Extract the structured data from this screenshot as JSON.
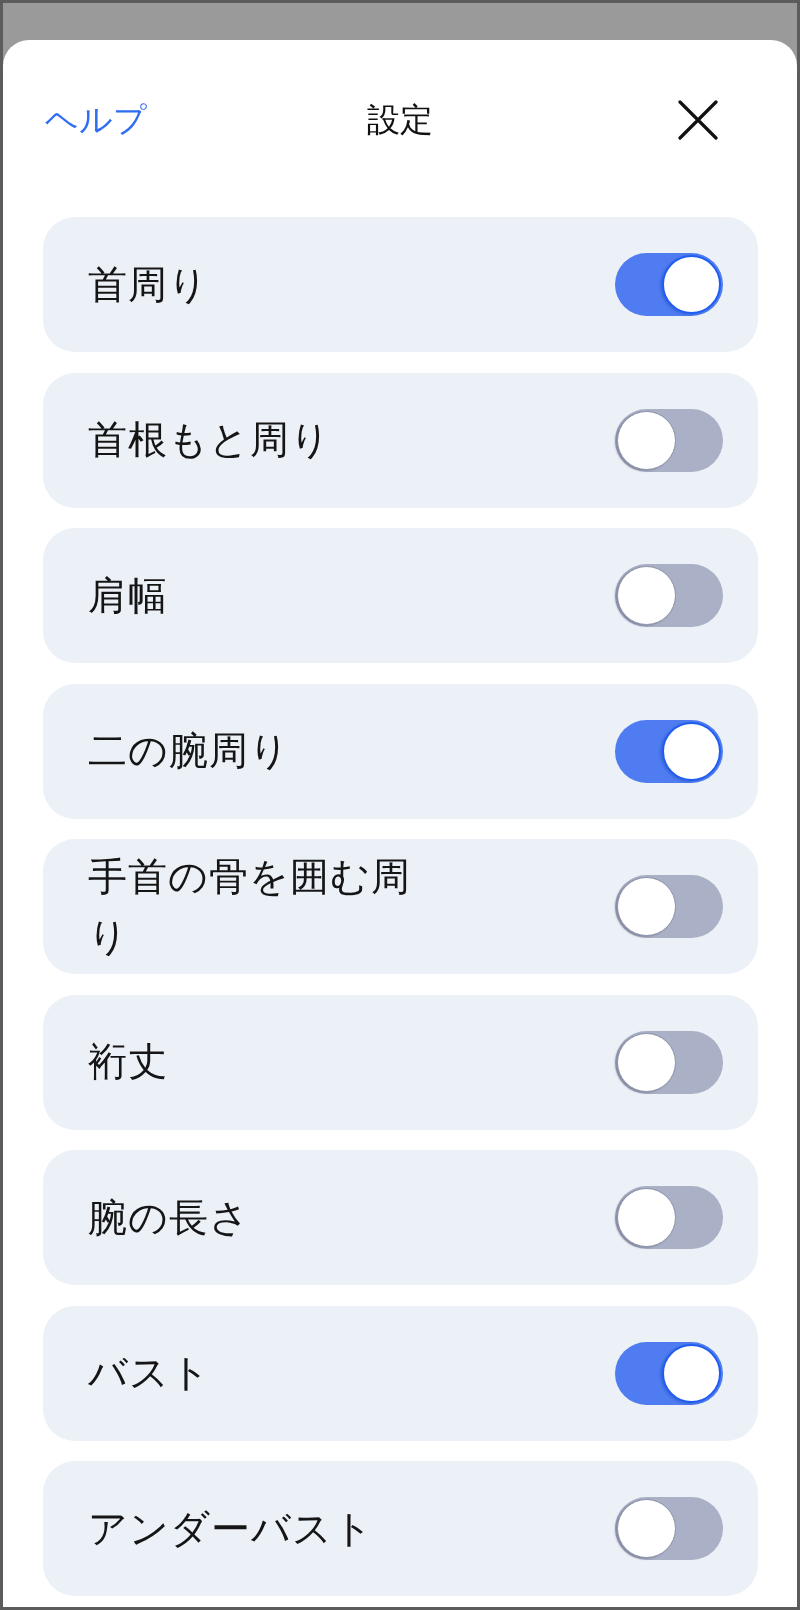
{
  "header": {
    "help_link": "ヘルプ",
    "title": "設定"
  },
  "settings": [
    {
      "label": "首周り",
      "on": true
    },
    {
      "label": "首根もと周り",
      "on": false
    },
    {
      "label": "肩幅",
      "on": false
    },
    {
      "label": "二の腕周り",
      "on": true
    },
    {
      "label": "手首の骨を囲む周り",
      "on": false
    },
    {
      "label": "裄丈",
      "on": false
    },
    {
      "label": "腕の長さ",
      "on": false
    },
    {
      "label": "バスト",
      "on": true
    },
    {
      "label": "アンダーバスト",
      "on": false
    }
  ]
}
